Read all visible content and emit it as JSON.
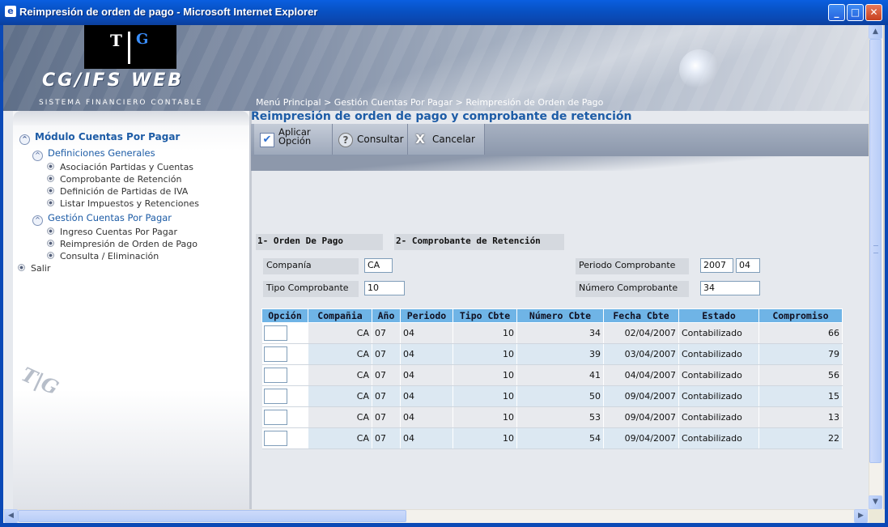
{
  "window": {
    "title": "Reimpresión de orden de pago - Microsoft Internet Explorer"
  },
  "branding": {
    "logo_left": "T",
    "logo_right": "G",
    "name": "CG/IFS WEB",
    "subtitle": "SISTEMA FINANCIERO CONTABLE"
  },
  "breadcrumb": "Menú Principal > Gestión Cuentas Por Pagar > Reimpresión de Orden de Pago",
  "sidebar": {
    "module": "Módulo Cuentas Por Pagar",
    "groups": [
      {
        "label": "Definiciones Generales",
        "items": [
          "Asociación Partidas y Cuentas",
          "Comprobante de Retención",
          "Definición de Partidas de IVA",
          "Listar Impuestos y Retenciones"
        ]
      },
      {
        "label": "Gestión Cuentas Por Pagar",
        "items": [
          "Ingreso Cuentas Por Pagar",
          "Reimpresión de Orden de Pago",
          "Consulta / Eliminación"
        ]
      }
    ],
    "exit": "Salir"
  },
  "page_title": "Reimpresión de orden de pago y comprobante de retención",
  "toolbar": {
    "apply_line1": "Aplicar",
    "apply_line2": "Opción",
    "consult": "Consultar",
    "cancel": "Cancelar"
  },
  "sections": {
    "order": "1- Orden De Pago",
    "retention": "2- Comprobante de Retención"
  },
  "form": {
    "company_label": "Companía",
    "company_value": "CA",
    "type_label": "Tipo Comprobante",
    "type_value": "10",
    "period_label": "Periodo Comprobante",
    "period_year": "2007",
    "period_month": "04",
    "number_label": "Número Comprobante",
    "number_value": "34"
  },
  "table": {
    "headers": [
      "Opción",
      "Compañia",
      "Año",
      "Periodo",
      "Tipo Cbte",
      "Número Cbte",
      "Fecha Cbte",
      "Estado",
      "Compromiso"
    ],
    "rows": [
      [
        "CA",
        "07",
        "04",
        "10",
        "34",
        "02/04/2007",
        "Contabilizado",
        "66"
      ],
      [
        "CA",
        "07",
        "04",
        "10",
        "39",
        "03/04/2007",
        "Contabilizado",
        "79"
      ],
      [
        "CA",
        "07",
        "04",
        "10",
        "41",
        "04/04/2007",
        "Contabilizado",
        "56"
      ],
      [
        "CA",
        "07",
        "04",
        "10",
        "50",
        "09/04/2007",
        "Contabilizado",
        "15"
      ],
      [
        "CA",
        "07",
        "04",
        "10",
        "53",
        "09/04/2007",
        "Contabilizado",
        "13"
      ],
      [
        "CA",
        "07",
        "04",
        "10",
        "54",
        "09/04/2007",
        "Contabilizado",
        "22"
      ]
    ]
  }
}
